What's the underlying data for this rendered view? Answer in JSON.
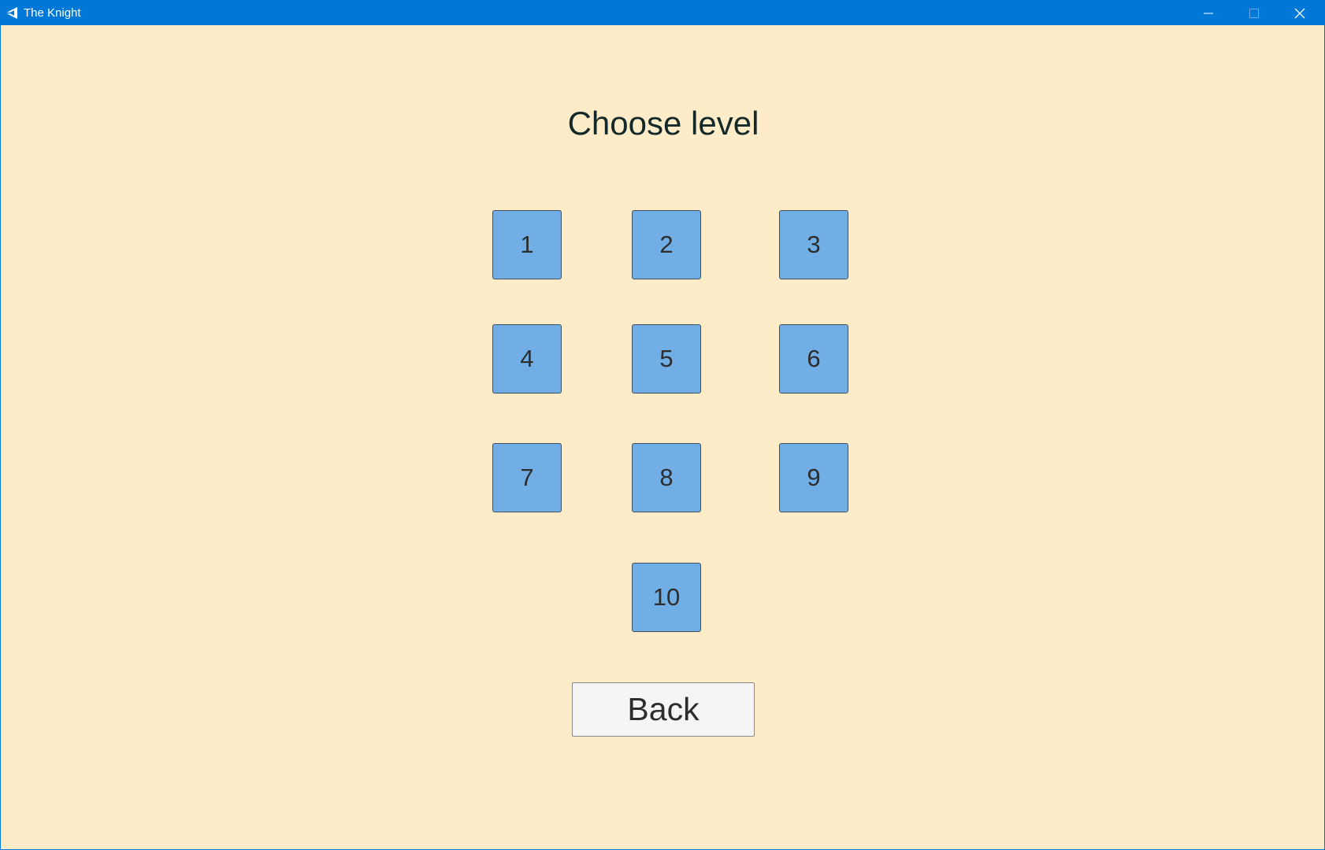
{
  "window": {
    "title": "The Knight",
    "app_icon": "unity-icon",
    "controls": {
      "minimize_icon": "minimize-icon",
      "maximize_icon": "maximize-icon",
      "close_icon": "close-icon"
    }
  },
  "menu": {
    "heading": "Choose level",
    "levels": [
      "1",
      "2",
      "3",
      "4",
      "5",
      "6",
      "7",
      "8",
      "9",
      "10"
    ],
    "back_label": "Back"
  },
  "colors": {
    "titlebar": "#0078d7",
    "background": "#feebc8",
    "level_button": "#70aee5",
    "back_button": "#f5f5f5",
    "text": "#2d2d2d"
  }
}
